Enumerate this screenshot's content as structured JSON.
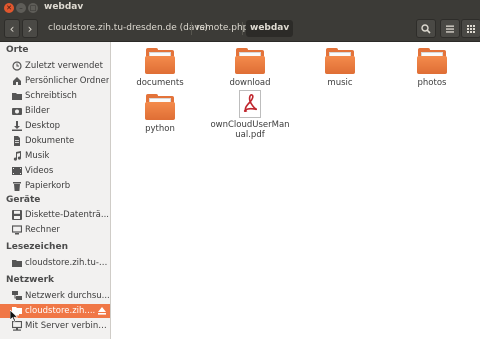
{
  "window": {
    "title": "webdav"
  },
  "toolbar": {
    "breadcrumbs": [
      "cloudstore.zih.tu-dresden.de (davs)",
      "remote.php",
      "webdav"
    ]
  },
  "sidebar": {
    "sections": {
      "orte": "Orte",
      "geraete": "Geräte",
      "lesezeichen": "Lesezeichen",
      "netzwerk": "Netzwerk"
    },
    "orte_items": [
      {
        "label": "Zuletzt verwendet",
        "icon": "clock-icon"
      },
      {
        "label": "Persönlicher Ordner",
        "icon": "home-icon"
      },
      {
        "label": "Schreibtisch",
        "icon": "desktop-folder-icon"
      },
      {
        "label": "Bilder",
        "icon": "camera-icon"
      },
      {
        "label": "Desktop",
        "icon": "download-icon"
      },
      {
        "label": "Dokumente",
        "icon": "document-icon"
      },
      {
        "label": "Musik",
        "icon": "music-icon"
      },
      {
        "label": "Videos",
        "icon": "video-icon"
      },
      {
        "label": "Papierkorb",
        "icon": "trash-icon"
      }
    ],
    "geraete_items": [
      {
        "label": "Diskette-Datenträ...",
        "icon": "floppy-icon"
      },
      {
        "label": "Rechner",
        "icon": "computer-icon"
      }
    ],
    "lesezeichen_items": [
      {
        "label": "cloudstore.zih.tu-d...",
        "icon": "folder-icon"
      }
    ],
    "netzwerk_items": [
      {
        "label": "Netzwerk durchsu...",
        "icon": "network-icon"
      },
      {
        "label": "cloudstore.zih....",
        "icon": "network-share-icon",
        "selected": true
      },
      {
        "label": "Mit Server verbinden",
        "icon": "server-icon"
      }
    ]
  },
  "files": [
    {
      "name": "documents",
      "type": "folder"
    },
    {
      "name": "download",
      "type": "folder"
    },
    {
      "name": "music",
      "type": "folder"
    },
    {
      "name": "photos",
      "type": "folder"
    },
    {
      "name": "python",
      "type": "folder"
    },
    {
      "name": "ownCloudUserManual.pdf",
      "type": "pdf"
    }
  ],
  "colors": {
    "accent": "#f07746",
    "titlebar": "#3c3b37",
    "folder": "#e3733a",
    "close_button": "#e1572e"
  }
}
